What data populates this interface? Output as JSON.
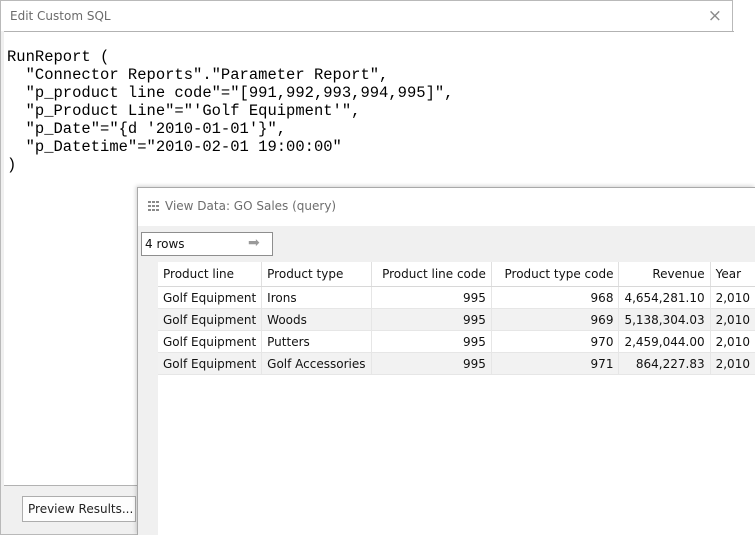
{
  "sql_dialog": {
    "title": "Edit Custom SQL",
    "close_label": "×",
    "code": "RunReport (\n  \"Connector Reports\".\"Parameter Report\",\n  \"p_product line code\"=\"[991,992,993,994,995]\",\n  \"p_Product Line\"=\"'Golf Equipment'\",\n  \"p_Date\"=\"{d '2010-01-01'}\",\n  \"p_Datetime\"=\"2010-02-01 19:00:00\"\n)",
    "preview_button": "Preview Results..."
  },
  "view_data": {
    "title": "View Data:  GO Sales (query)",
    "title_icon": "grid-icon",
    "rows_value": "4 rows",
    "rows_arrow": "➡",
    "columns": [
      "Product line",
      "Product type",
      "Product line code",
      "Product type code",
      "Revenue",
      "Year"
    ],
    "rows": [
      [
        "Golf Equipment",
        "Irons",
        "995",
        "968",
        "4,654,281.10",
        "2,010"
      ],
      [
        "Golf Equipment",
        "Woods",
        "995",
        "969",
        "5,138,304.03",
        "2,010"
      ],
      [
        "Golf Equipment",
        "Putters",
        "995",
        "970",
        "2,459,044.00",
        "2,010"
      ],
      [
        "Golf Equipment",
        "Golf Accessories",
        "995",
        "971",
        "864,227.83",
        "2,010"
      ]
    ]
  }
}
